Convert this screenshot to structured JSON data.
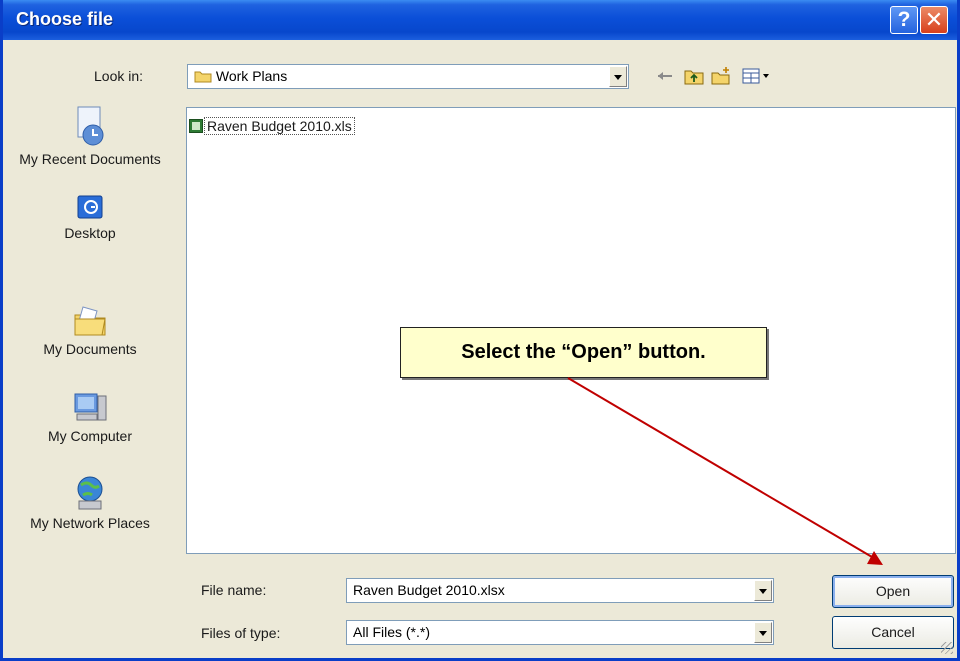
{
  "dialog": {
    "title": "Choose file"
  },
  "lookin": {
    "label": "Look in:",
    "value": "Work Plans"
  },
  "toolbar": {
    "icons": [
      "back-arrow-icon",
      "up-folder-icon",
      "new-folder-icon",
      "views-menu-icon"
    ]
  },
  "places": [
    {
      "label": "My Recent Documents",
      "icon": "recent-documents-icon"
    },
    {
      "label": "Desktop",
      "icon": "desktop-icon"
    },
    {
      "label": "My Documents",
      "icon": "my-documents-icon"
    },
    {
      "label": "My Computer",
      "icon": "my-computer-icon"
    },
    {
      "label": "My Network Places",
      "icon": "network-places-icon"
    }
  ],
  "files": [
    {
      "name": "Raven Budget 2010.xls",
      "icon": "excel-file-icon"
    }
  ],
  "filename": {
    "label": "File name:",
    "value": "Raven Budget 2010.xlsx"
  },
  "filetype": {
    "label": "Files of type:",
    "value": "All Files (*.*)"
  },
  "buttons": {
    "open": "Open",
    "cancel": "Cancel"
  },
  "callout": {
    "text": "Select the “Open” button."
  },
  "colors": {
    "titlebar": "#0b4fd8",
    "callout_bg": "#ffffcc",
    "arrow": "#c00000"
  }
}
